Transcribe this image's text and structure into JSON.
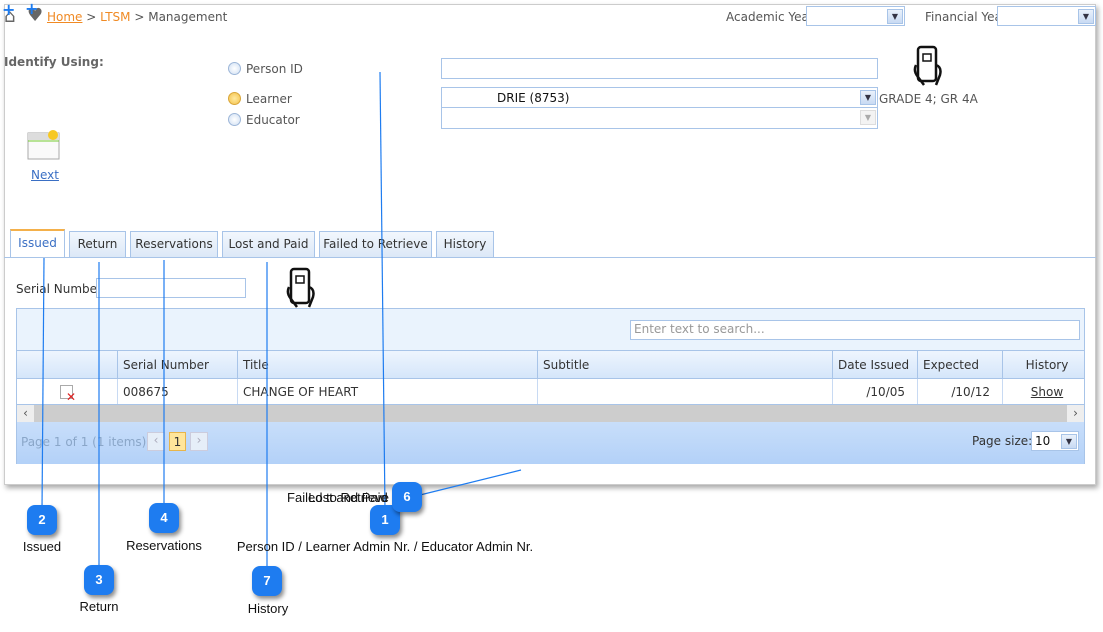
{
  "breadcrumb": {
    "home": "Home",
    "sep1": ">",
    "module": "LTSM",
    "sep2": ">",
    "page": "Management"
  },
  "header": {
    "academic_year_label": "Academic Year",
    "academic_year_value": "",
    "financial_year_label": "Financial Year",
    "financial_year_value": ""
  },
  "identify": {
    "label": "Identify Using:",
    "options": [
      {
        "label": "Person ID",
        "selected": false
      },
      {
        "label": "Learner",
        "selected": true
      },
      {
        "label": "Educator",
        "selected": false
      }
    ],
    "person_id_value": "",
    "learner_value": "DRIE (8753)",
    "educator_value": "",
    "learner_grade": "GRADE 4; GR 4A"
  },
  "next_label": "Next",
  "tabs": [
    {
      "label": "Issued",
      "active": true
    },
    {
      "label": "Return"
    },
    {
      "label": "Reservations"
    },
    {
      "label": "Lost and Paid"
    },
    {
      "label": "Failed to Retrieve"
    },
    {
      "label": "History"
    }
  ],
  "serial": {
    "label": "Serial Number",
    "value": ""
  },
  "grid": {
    "search_placeholder": "Enter text to search...",
    "columns": [
      "",
      "Serial Number",
      "Title",
      "Subtitle",
      "Date Issued",
      "Expected Date",
      "History"
    ],
    "rows": [
      {
        "serial": "008675",
        "title": "CHANGE OF HEART",
        "subtitle": "",
        "date_issued": "/10/05",
        "expected_date": "/10/12",
        "history": "Show"
      }
    ],
    "pager_text": "Page 1 of 1 (1 items)",
    "current_page": "1",
    "page_size_label": "Page size:",
    "page_size": "10"
  },
  "callouts": [
    {
      "num": "1",
      "label": "Person ID / Learner Admin Nr. / Educator Admin Nr."
    },
    {
      "num": "2",
      "label": "Issued"
    },
    {
      "num": "3",
      "label": "Return"
    },
    {
      "num": "4",
      "label": "Reservations"
    },
    {
      "num": "6",
      "label": "Failed to Retrieve",
      "label2": "Lost and Paid"
    },
    {
      "num": "7",
      "label": "History"
    }
  ],
  "colors": {
    "accent": "#1e7cf0",
    "breadcrumb": "#f08a24",
    "border": "#a8c4e8"
  }
}
